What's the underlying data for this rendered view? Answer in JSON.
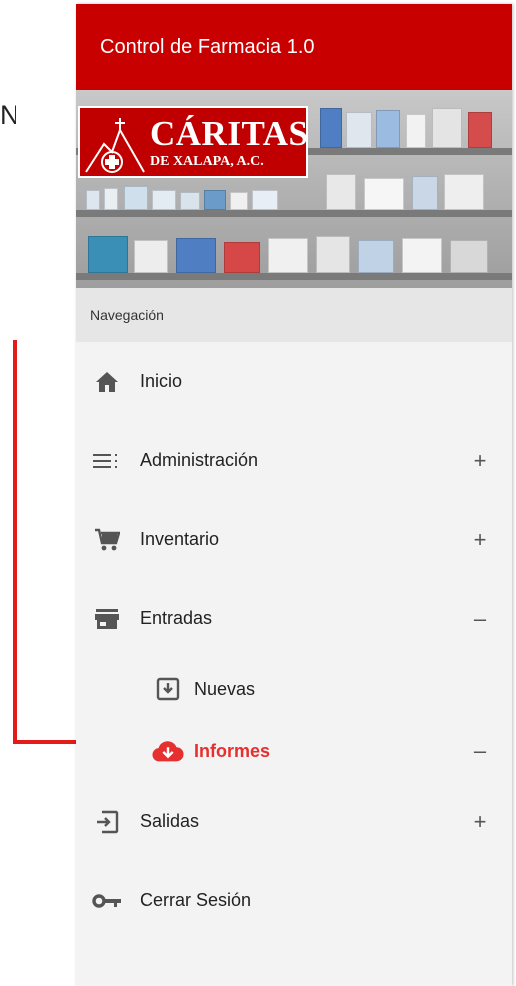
{
  "side_text": "N",
  "header": {
    "title": "Control de Farmacia 1.0"
  },
  "logo": {
    "name": "CÁRITAS",
    "subtitle": "DE XALAPA, A.C."
  },
  "nav": {
    "title": "Navegación",
    "items": [
      {
        "label": "Inicio",
        "icon": "home-icon",
        "toggle": ""
      },
      {
        "label": "Administración",
        "icon": "list-icon",
        "toggle": "+"
      },
      {
        "label": "Inventario",
        "icon": "cart-icon",
        "toggle": "+"
      },
      {
        "label": "Entradas",
        "icon": "store-icon",
        "toggle": "–"
      },
      {
        "label": "Nuevas",
        "icon": "inbox-download-icon",
        "toggle": ""
      },
      {
        "label": "Informes",
        "icon": "cloud-download-icon",
        "toggle": "–"
      },
      {
        "label": "Salidas",
        "icon": "exit-to-app-icon",
        "toggle": "+"
      },
      {
        "label": "Cerrar Sesión",
        "icon": "key-icon",
        "toggle": ""
      }
    ]
  },
  "colors": {
    "primary": "#c90000",
    "active": "#e62f2f",
    "annotation": "#e31b1b"
  }
}
